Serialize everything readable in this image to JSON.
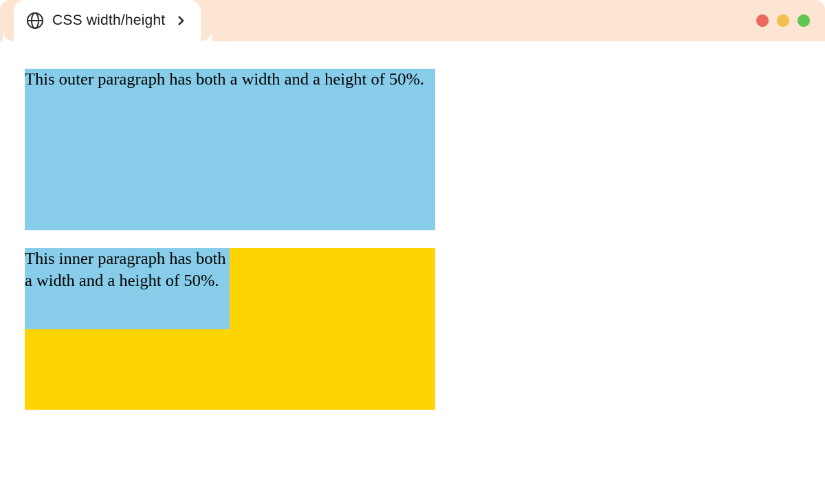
{
  "titlebar": {
    "tab_title": "CSS width/height"
  },
  "content": {
    "outer_paragraph_text": "This outer paragraph has both a width and a height of 50%.",
    "inner_paragraph_text": "This inner paragraph has both a width and a height of 50%."
  },
  "colors": {
    "blue": "#87cde9",
    "gold": "#ffd403",
    "tabbar": "#fce6d3"
  }
}
